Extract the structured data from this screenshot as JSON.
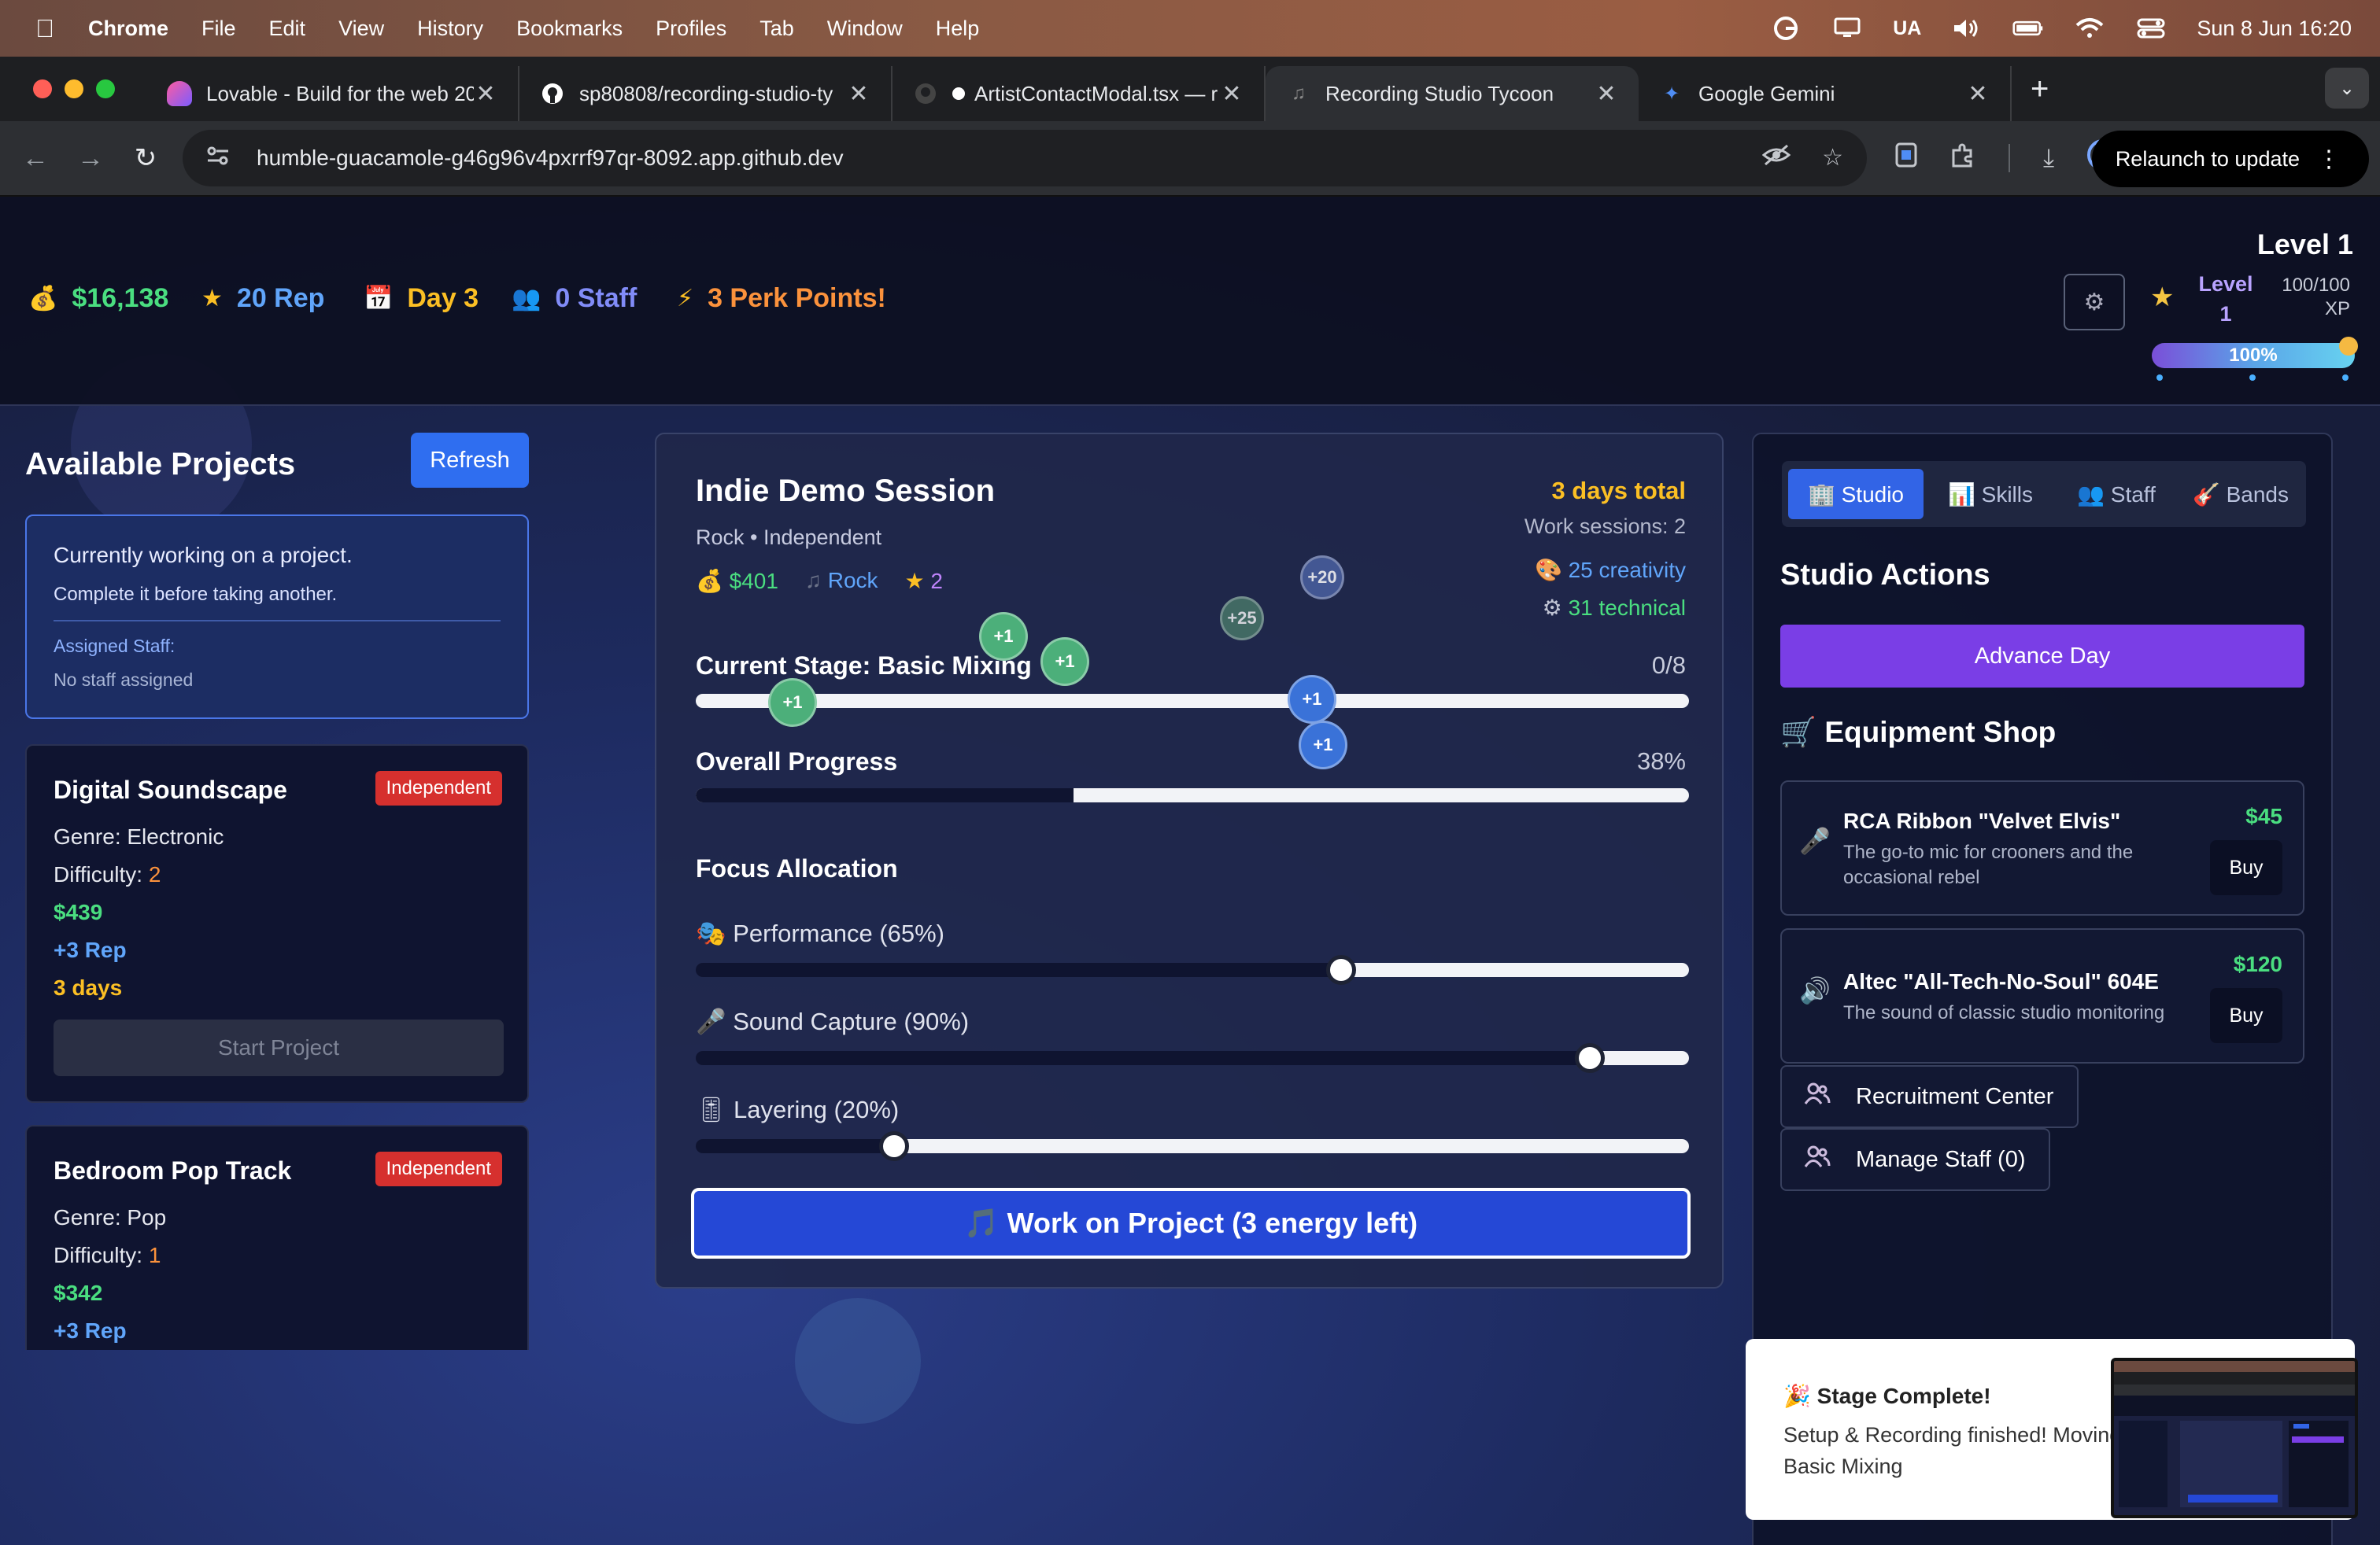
{
  "menubar": {
    "app": "Chrome",
    "items": [
      "File",
      "Edit",
      "View",
      "History",
      "Bookmarks",
      "Profiles",
      "Tab",
      "Window",
      "Help"
    ],
    "input_source": "UA",
    "datetime": "Sun 8 Jun  16:20"
  },
  "tabs": [
    {
      "title": "Lovable - Build for the web 20",
      "icon": "lovable-heart-icon"
    },
    {
      "title": "sp80808/recording-studio-ty",
      "icon": "github-icon"
    },
    {
      "title": "ArtistContactModal.tsx — r",
      "icon": "github-icon"
    },
    {
      "title": "Recording Studio Tycoon",
      "icon": "music-note-icon"
    },
    {
      "title": "Google Gemini",
      "icon": "gemini-star-icon"
    }
  ],
  "address": {
    "url": "humble-guacamole-g46g96v4pxrrf97qr-8092.app.github.dev",
    "relaunch_label": "Relaunch to update"
  },
  "stats": {
    "money": "$16,138",
    "rep": "20 Rep",
    "day": "Day 3",
    "staff": "0 Staff",
    "perks": "3 Perk Points!"
  },
  "level": {
    "title": "Level 1",
    "label": "Level 1",
    "xp": "100/100 XP",
    "progress_label": "100%",
    "progress": 1.0
  },
  "projects": {
    "title": "Available Projects",
    "refresh": "Refresh",
    "working": {
      "line1": "Currently working on a project.",
      "line2": "Complete it before taking another.",
      "assigned_label": "Assigned Staff:",
      "assigned_value": "No staff assigned"
    },
    "list": [
      {
        "name": "Digital Soundscape",
        "badge": "Independent",
        "genre": "Genre: Electronic",
        "difficulty_label": "Difficulty: ",
        "difficulty": "2",
        "pay": "$439",
        "rep": "+3 Rep",
        "days": "3 days",
        "start": "Start Project"
      },
      {
        "name": "Bedroom Pop Track",
        "badge": "Independent",
        "genre": "Genre: Pop",
        "difficulty_label": "Difficulty: ",
        "difficulty": "1",
        "pay": "$342",
        "rep": "+3 Rep"
      }
    ]
  },
  "session": {
    "title": "Indie Demo Session",
    "subtitle": "Rock • Independent",
    "pay": "$401",
    "genre": "Rock",
    "stars": "2",
    "days_total": "3 days total",
    "work_sessions": "Work sessions: 2",
    "creativity": "25 creativity",
    "technical": "31 technical",
    "stage_label": "Current Stage: Basic Mixing",
    "stage_count": "0/8",
    "overall_label": "Overall Progress",
    "overall_pct": "38%",
    "overall_progress": 0.38,
    "focus_title": "Focus Allocation",
    "focus": [
      {
        "label": "Performance (65%)",
        "value": 0.65,
        "icon": "theater-masks-icon"
      },
      {
        "label": "Sound Capture (90%)",
        "value": 0.9,
        "icon": "microphone-icon"
      },
      {
        "label": "Layering (20%)",
        "value": 0.2,
        "icon": "mixer-icon"
      }
    ],
    "bubbles": [
      "+1",
      "+1",
      "+25",
      "+20",
      "+1",
      "+1",
      "+1"
    ],
    "work_button": "🎵 Work on Project (3 energy left)"
  },
  "right": {
    "tabs": [
      "🏢 Studio",
      "📊 Skills",
      "👥 Staff",
      "🎸 Bands"
    ],
    "actions_title": "Studio Actions",
    "advance": "Advance Day",
    "shop_title": "🛒 Equipment Shop",
    "equipment": [
      {
        "name": "RCA Ribbon \"Velvet Elvis\"",
        "desc": "The go-to mic for crooners and the occasional rebel",
        "price": "$45",
        "buy": "Buy",
        "icon": "microphone-icon"
      },
      {
        "name": "Altec \"All-Tech-No-Soul\" 604E",
        "desc": "The sound of classic studio monitoring",
        "price": "$120",
        "buy": "Buy",
        "icon": "speaker-icon"
      }
    ],
    "recruitment": "Recruitment Center",
    "manage_staff": "Manage Staff (0)"
  },
  "toast": {
    "title": "🎉 Stage Complete!",
    "body": "Setup & Recording finished! Moving to Basic Mixing"
  },
  "colors": {
    "money": "#4ade80",
    "rep": "#60a5fa",
    "day": "#fbbf24",
    "staff": "#818cf8",
    "perks": "#fb923c",
    "accent": "#2f6ef0",
    "purple": "#7a3ee6"
  }
}
